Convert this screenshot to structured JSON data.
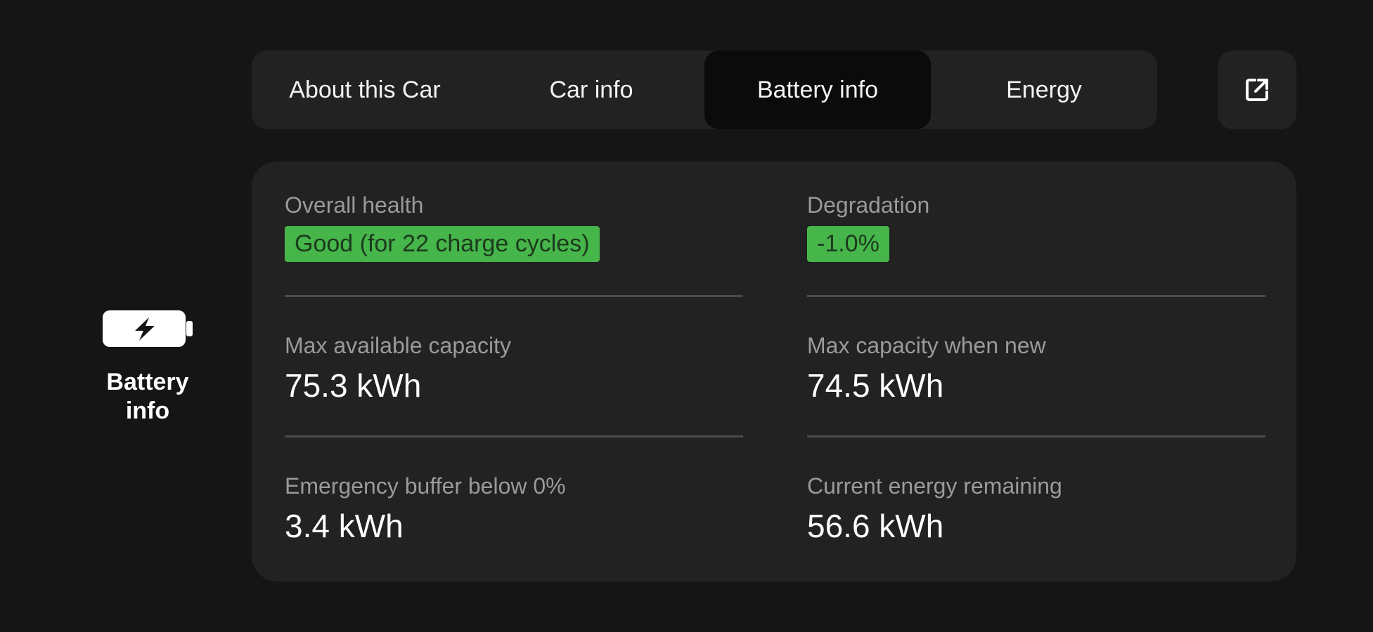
{
  "sidebar": {
    "item": {
      "label": "Battery info",
      "icon": "battery-charging-icon"
    }
  },
  "tabs": [
    {
      "label": "About this Car",
      "active": false
    },
    {
      "label": "Car info",
      "active": false
    },
    {
      "label": "Battery info",
      "active": true
    },
    {
      "label": "Energy",
      "active": false
    }
  ],
  "external_button": {
    "icon": "open-external-icon"
  },
  "battery": {
    "overall_health": {
      "label": "Overall health",
      "value": "Good (for 22 charge cycles)"
    },
    "degradation": {
      "label": "Degradation",
      "value": "-1.0%"
    },
    "max_available_capacity": {
      "label": "Max available capacity",
      "value": "75.3 kWh"
    },
    "max_capacity_new": {
      "label": "Max capacity when new",
      "value": "74.5 kWh"
    },
    "emergency_buffer": {
      "label": "Emergency buffer below 0%",
      "value": "3.4 kWh"
    },
    "current_energy": {
      "label": "Current energy remaining",
      "value": "56.6 kWh"
    }
  },
  "colors": {
    "background": "#151515",
    "panel": "#222222",
    "active_tab": "#0b0b0b",
    "badge_green": "#46b54a",
    "label_gray": "#9a9a9a"
  }
}
